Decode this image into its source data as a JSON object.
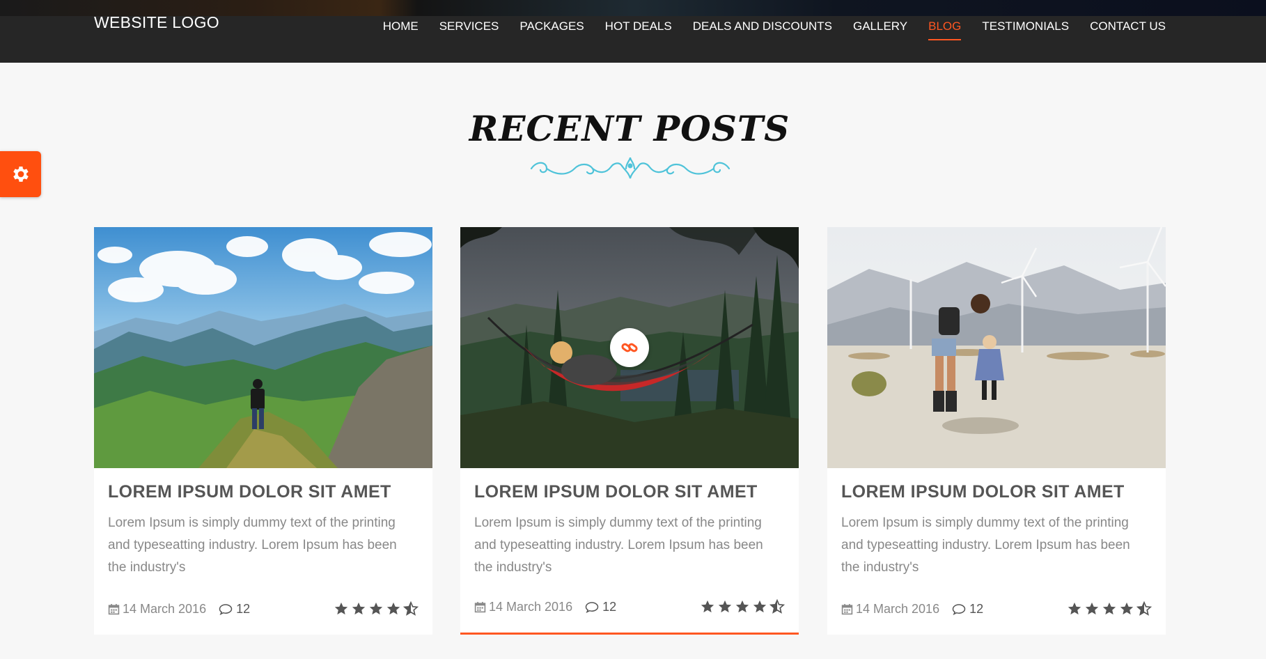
{
  "header": {
    "logo": "WEBSITE LOGO",
    "nav": [
      {
        "label": "HOME",
        "active": false
      },
      {
        "label": "SERVICES",
        "active": false
      },
      {
        "label": "PACKAGES",
        "active": false
      },
      {
        "label": "HOT DEALS",
        "active": false
      },
      {
        "label": "DEALS AND DISCOUNTS",
        "active": false
      },
      {
        "label": "GALLERY",
        "active": false
      },
      {
        "label": "BLOG",
        "active": true
      },
      {
        "label": "TESTIMONIALS",
        "active": false
      },
      {
        "label": "CONTACT US",
        "active": false
      }
    ]
  },
  "settings": {
    "icon": "gear-icon"
  },
  "section": {
    "title": "RECENT POSTS"
  },
  "posts": [
    {
      "title": "LOREM IPSUM DOLOR SIT AMET",
      "excerpt": "Lorem Ipsum is simply dummy text of the printing and typeseatting industry. Lorem Ipsum has been the industry's",
      "date": "14 March 2016",
      "comments": "12",
      "rating": 4.5,
      "image": "mountain-hiker"
    },
    {
      "title": "LOREM IPSUM DOLOR SIT AMET",
      "excerpt": "Lorem Ipsum is simply dummy text of the printing and typeseatting industry. Lorem Ipsum has been the industry's",
      "date": "14 March 2016",
      "comments": "12",
      "rating": 4.5,
      "image": "hammock-forest",
      "link_icon": "link-icon"
    },
    {
      "title": "LOREM IPSUM DOLOR SIT AMET",
      "excerpt": "Lorem Ipsum is simply dummy text of the printing and typeseatting industry. Lorem Ipsum has been the industry's",
      "date": "14 March 2016",
      "comments": "12",
      "rating": 4.5,
      "image": "desert-windmills"
    }
  ],
  "colors": {
    "accent": "#ff5722",
    "header_bg": "#262626",
    "ornament": "#4fc3d9",
    "star": "#555555"
  }
}
